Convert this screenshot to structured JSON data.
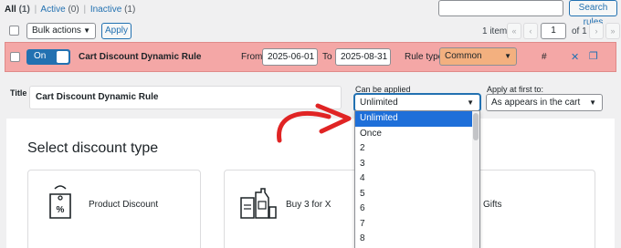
{
  "views": {
    "all_label": "All",
    "all_count": "(1)",
    "active_label": "Active",
    "active_count": "(0)",
    "inactive_label": "Inactive",
    "inactive_count": "(1)",
    "separator": "|"
  },
  "search": {
    "placeholder": "",
    "button_label": "Search rules"
  },
  "bulk": {
    "selected": "Bulk actions",
    "apply_label": "Apply"
  },
  "pagination": {
    "count": "1 item",
    "first": "«",
    "prev": "‹",
    "current": "1",
    "of_label": "of 1",
    "next": "›",
    "last": "»"
  },
  "rule": {
    "toggle_label": "On",
    "title": "Cart Discount Dynamic Rule",
    "from_label": "From",
    "from_value": "2025-06-01",
    "to_label": "To",
    "to_value": "2025-08-31",
    "type_label": "Rule type",
    "type_value": "Common",
    "hash": "#",
    "close": "✕",
    "copy": "❐"
  },
  "editor": {
    "title_label": "Title",
    "title_value": "Cart Discount Dynamic Rule",
    "can_label": "Can be applied",
    "can_value": "Unlimited",
    "apply_first_label": "Apply at first to:",
    "apply_first_value": "As appears in the cart",
    "section_heading": "Select discount type",
    "cards": [
      "Product Discount",
      "Buy 3 for X",
      "Gifts"
    ]
  },
  "dropdown": {
    "options": [
      "Unlimited",
      "Once",
      "2",
      "3",
      "4",
      "5",
      "6",
      "7",
      "8"
    ],
    "selected": "Unlimited"
  },
  "colors": {
    "rule_row_bg": "#f4a7a6",
    "rule_type_bg": "#f3b07f",
    "wp_blue": "#2271b1",
    "dropdown_highlight": "#1e6fd9",
    "arrow_red": "#e02424"
  },
  "icons": {
    "select_caret": "chevron-down-icon",
    "copy": "copy-icon",
    "close": "close-icon",
    "percent_tag": "percent-tag-icon",
    "bundle": "bundle-icon",
    "arrow": "red-arrow-annotation"
  }
}
